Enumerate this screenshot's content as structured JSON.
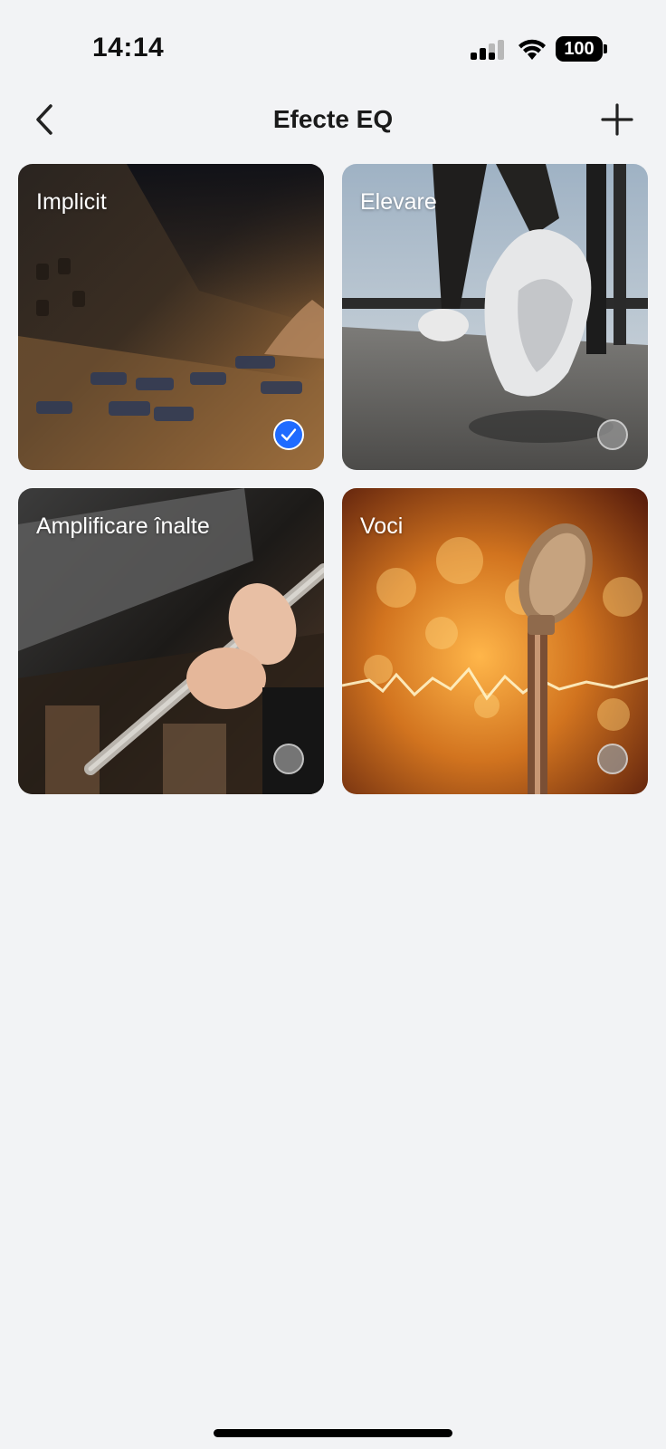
{
  "status_bar": {
    "time": "14:14",
    "battery": "100",
    "icons": [
      "cellular-signal-icon",
      "wifi-icon",
      "battery-icon"
    ]
  },
  "header": {
    "title": "Efecte EQ",
    "back_icon": "chevron-left-icon",
    "add_icon": "plus-icon"
  },
  "presets": [
    {
      "label": "Implicit",
      "selected": true,
      "image": "mixing-console"
    },
    {
      "label": "Elevare",
      "selected": false,
      "image": "treadmill-runner"
    },
    {
      "label": "Amplificare înalte",
      "selected": false,
      "image": "flute-player"
    },
    {
      "label": "Voci",
      "selected": false,
      "image": "vintage-microphone"
    }
  ],
  "colors": {
    "background": "#f2f3f5",
    "accent": "#1f6bff"
  }
}
